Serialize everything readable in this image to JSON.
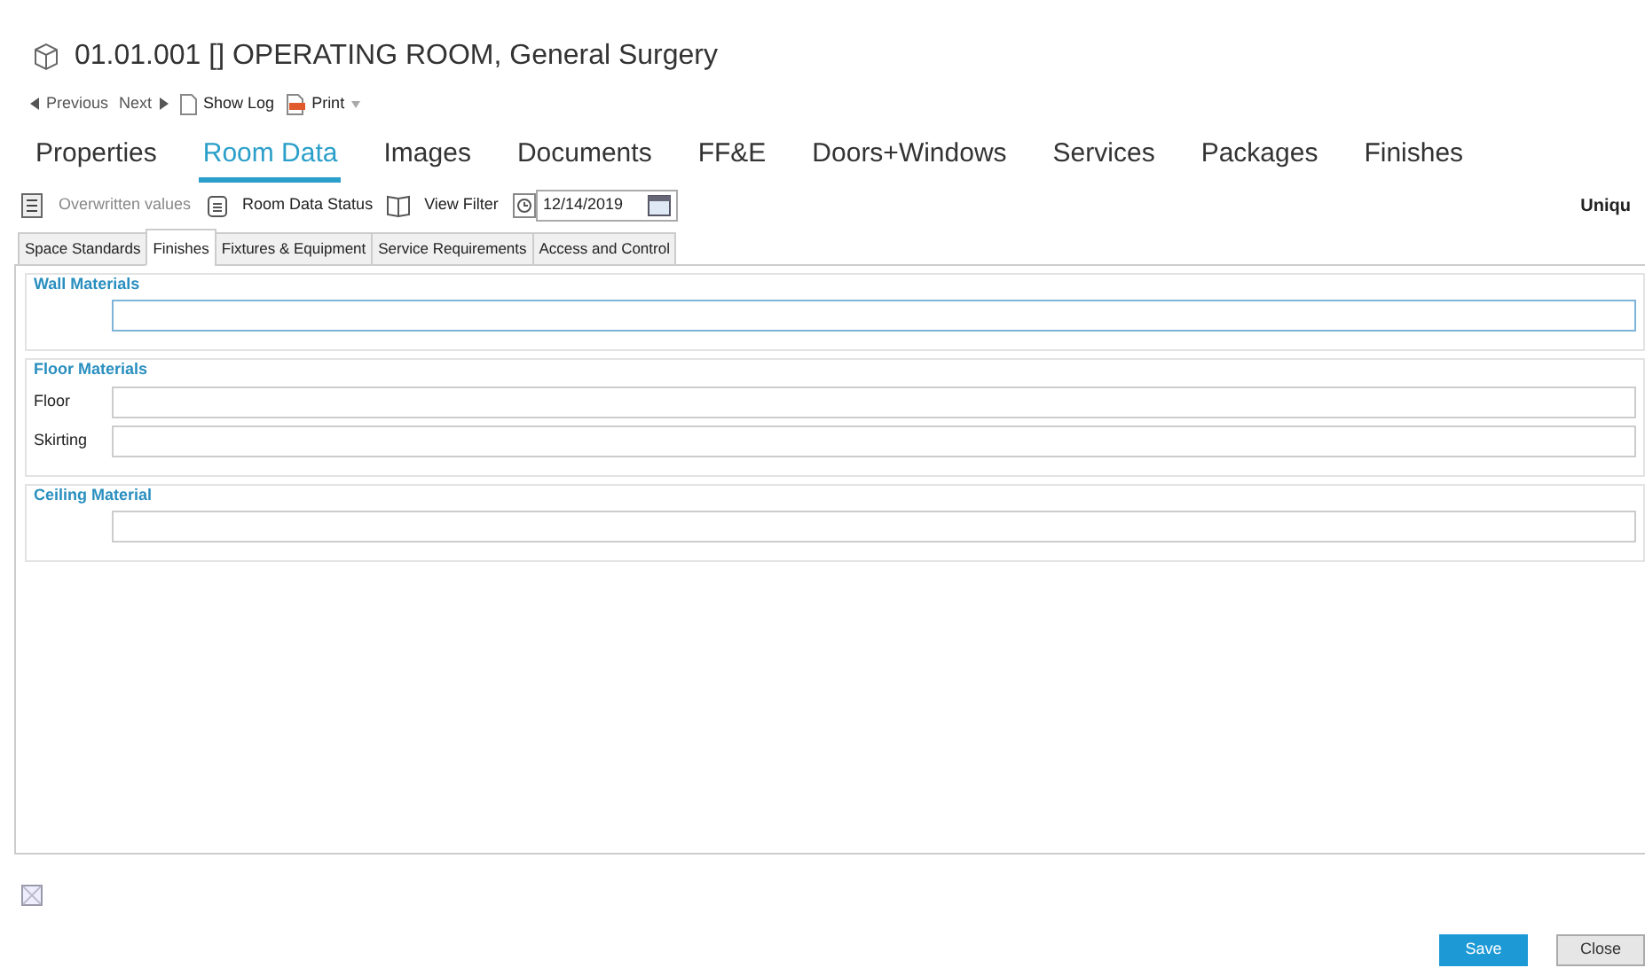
{
  "window": {
    "title": "01.01.001 [] OPERATING ROOM, General Surgery"
  },
  "nav": [
    {
      "label": "Previous",
      "kind": "prev"
    },
    {
      "label": "Next",
      "kind": "next"
    },
    {
      "label": "Show Log",
      "kind": "log"
    },
    {
      "label": "Print",
      "kind": "print"
    }
  ],
  "tabs": [
    {
      "label": "Properties",
      "selected": false
    },
    {
      "label": "Room Data",
      "selected": true
    },
    {
      "label": "Images",
      "selected": false
    },
    {
      "label": "Documents",
      "selected": false
    },
    {
      "label": "FF&E",
      "selected": false
    },
    {
      "label": "Doors+Windows",
      "selected": false
    },
    {
      "label": "Services",
      "selected": false
    },
    {
      "label": "Packages",
      "selected": false
    },
    {
      "label": "Finishes",
      "selected": false
    }
  ],
  "toolbar": {
    "items": [
      {
        "label": "Overwritten values",
        "kind": "overwritten",
        "disabled": true
      },
      {
        "label": "Room Data Status",
        "kind": "status",
        "disabled": false
      },
      {
        "label": "View Filter",
        "kind": "filter",
        "disabled": false
      }
    ],
    "date": "12/14/2019",
    "right_text": "Uniqu"
  },
  "subtabs": [
    {
      "label": "Space Standards",
      "selected": false
    },
    {
      "label": "Finishes",
      "selected": true
    },
    {
      "label": "Fixtures & Equipment",
      "selected": false
    },
    {
      "label": "Service Requirements",
      "selected": false
    },
    {
      "label": "Access and Control",
      "selected": false
    }
  ],
  "sections": [
    {
      "title": "Wall Materials",
      "fields": [
        {
          "focused": true
        }
      ]
    },
    {
      "title": "Floor Materials",
      "fields": [
        {
          "label": "Floor",
          "focused": false
        },
        {
          "label": "Skirting",
          "focused": false
        }
      ]
    },
    {
      "title": "Ceiling Material",
      "fields": [
        {
          "focused": false
        }
      ]
    }
  ],
  "buttons": [
    {
      "label": "Save",
      "kind": "primary"
    },
    {
      "label": "Close",
      "kind": "secondary"
    }
  ]
}
